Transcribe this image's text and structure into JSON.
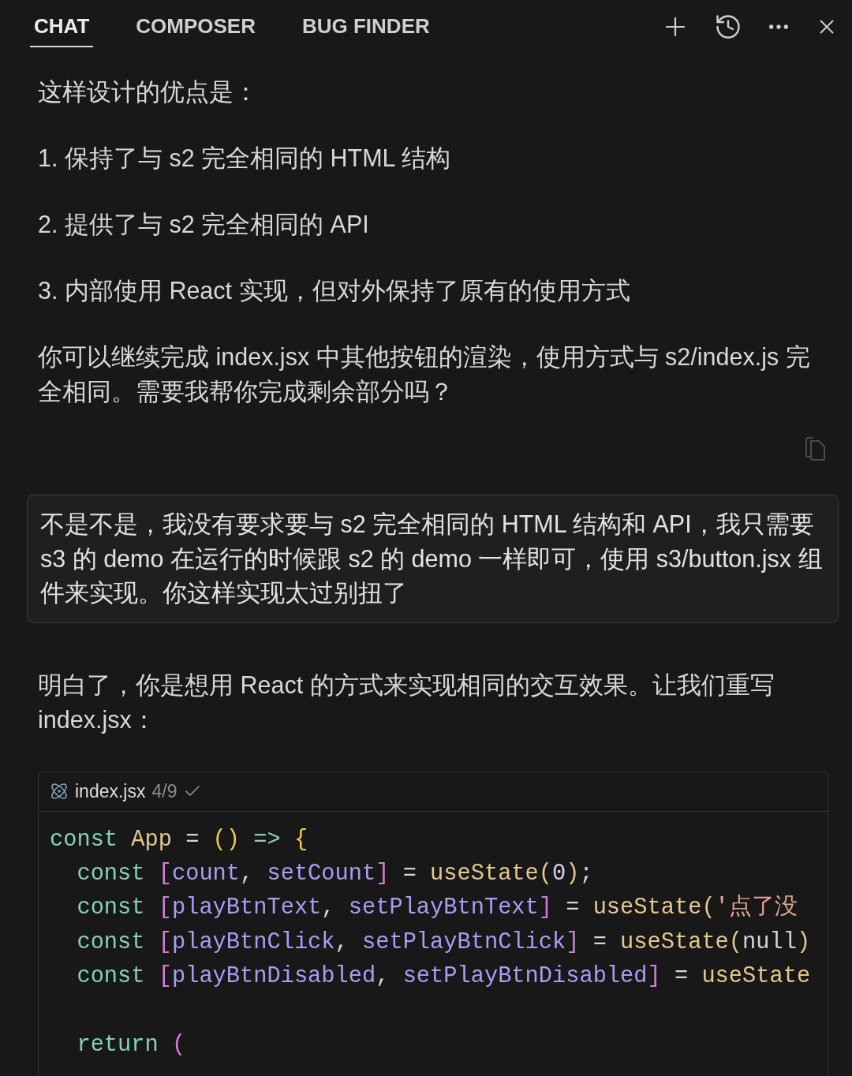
{
  "tabs": [
    {
      "label": "CHAT",
      "selected": true
    },
    {
      "label": "COMPOSER",
      "selected": false
    },
    {
      "label": "BUG FINDER",
      "selected": false
    }
  ],
  "messages": [
    {
      "kind": "assistant",
      "paragraphs": [
        "这样设计的优点是：",
        "1. 保持了与 s2 完全相同的 HTML 结构",
        "2. 提供了与 s2 完全相同的 API",
        "3. 内部使用 React 实现，但对外保持了原有的使用方式",
        "你可以继续完成 index.jsx 中其他按钮的渲染，使用方式与 s2/index.js 完全相同。需要我帮你完成剩余部分吗？"
      ]
    },
    {
      "kind": "user",
      "text": "不是不是，我没有要求要与 s2 完全相同的 HTML 结构和 API，我只需要 s3 的 demo 在运行的时候跟 s2 的 demo 一样即可，使用 s3/button.jsx 组件来实现。你这样实现太过别扭了"
    },
    {
      "kind": "assistant",
      "paragraphs": [
        "明白了，你是想用 React 的方式来实现相同的交互效果。让我们重写 index.jsx："
      ],
      "code": {
        "filename": "index.jsx",
        "counter": "4/9",
        "applied": true,
        "lines": [
          {
            "kind": "code",
            "tokens": [
              {
                "text": "const ",
                "kind": "keyword"
              },
              {
                "text": "App",
                "kind": "function"
              },
              {
                "text": " = ",
                "kind": "plain"
              },
              {
                "text": "()",
                "kind": "bracket1"
              },
              {
                "text": " => ",
                "kind": "keyword"
              },
              {
                "text": "{",
                "kind": "bracket1"
              }
            ]
          },
          {
            "kind": "code",
            "tokens": [
              {
                "text": "  const ",
                "kind": "keyword"
              },
              {
                "text": "[",
                "kind": "bracket2"
              },
              {
                "text": "count",
                "kind": "variable"
              },
              {
                "text": ", ",
                "kind": "plain"
              },
              {
                "text": "setCount",
                "kind": "variable"
              },
              {
                "text": "]",
                "kind": "bracket2"
              },
              {
                "text": " = ",
                "kind": "plain"
              },
              {
                "text": "useState",
                "kind": "function"
              },
              {
                "text": "(",
                "kind": "paren"
              },
              {
                "text": "0",
                "kind": "number"
              },
              {
                "text": ")",
                "kind": "paren"
              },
              {
                "text": ";",
                "kind": "plain"
              }
            ]
          },
          {
            "kind": "code",
            "tokens": [
              {
                "text": "  const ",
                "kind": "keyword"
              },
              {
                "text": "[",
                "kind": "bracket2"
              },
              {
                "text": "playBtnText",
                "kind": "variable"
              },
              {
                "text": ", ",
                "kind": "plain"
              },
              {
                "text": "setPlayBtnText",
                "kind": "variable"
              },
              {
                "text": "]",
                "kind": "bracket2"
              },
              {
                "text": " = ",
                "kind": "plain"
              },
              {
                "text": "useState",
                "kind": "function"
              },
              {
                "text": "(",
                "kind": "paren"
              },
              {
                "text": "'点了没",
                "kind": "string"
              }
            ]
          },
          {
            "kind": "code",
            "tokens": [
              {
                "text": "  const ",
                "kind": "keyword"
              },
              {
                "text": "[",
                "kind": "bracket2"
              },
              {
                "text": "playBtnClick",
                "kind": "variable"
              },
              {
                "text": ", ",
                "kind": "plain"
              },
              {
                "text": "setPlayBtnClick",
                "kind": "variable"
              },
              {
                "text": "]",
                "kind": "bracket2"
              },
              {
                "text": " = ",
                "kind": "plain"
              },
              {
                "text": "useState",
                "kind": "function"
              },
              {
                "text": "(",
                "kind": "paren"
              },
              {
                "text": "null",
                "kind": "plain"
              },
              {
                "text": ")",
                "kind": "paren"
              }
            ]
          },
          {
            "kind": "code",
            "tokens": [
              {
                "text": "  const ",
                "kind": "keyword"
              },
              {
                "text": "[",
                "kind": "bracket2"
              },
              {
                "text": "playBtnDisabled",
                "kind": "variable"
              },
              {
                "text": ", ",
                "kind": "plain"
              },
              {
                "text": "setPlayBtnDisabled",
                "kind": "variable"
              },
              {
                "text": "]",
                "kind": "bracket2"
              },
              {
                "text": " = ",
                "kind": "plain"
              },
              {
                "text": "useState",
                "kind": "function"
              }
            ]
          },
          {
            "kind": "blank"
          },
          {
            "kind": "code",
            "tokens": [
              {
                "text": "  return ",
                "kind": "keyword"
              },
              {
                "text": "(",
                "kind": "bracket2"
              }
            ]
          }
        ]
      }
    }
  ]
}
